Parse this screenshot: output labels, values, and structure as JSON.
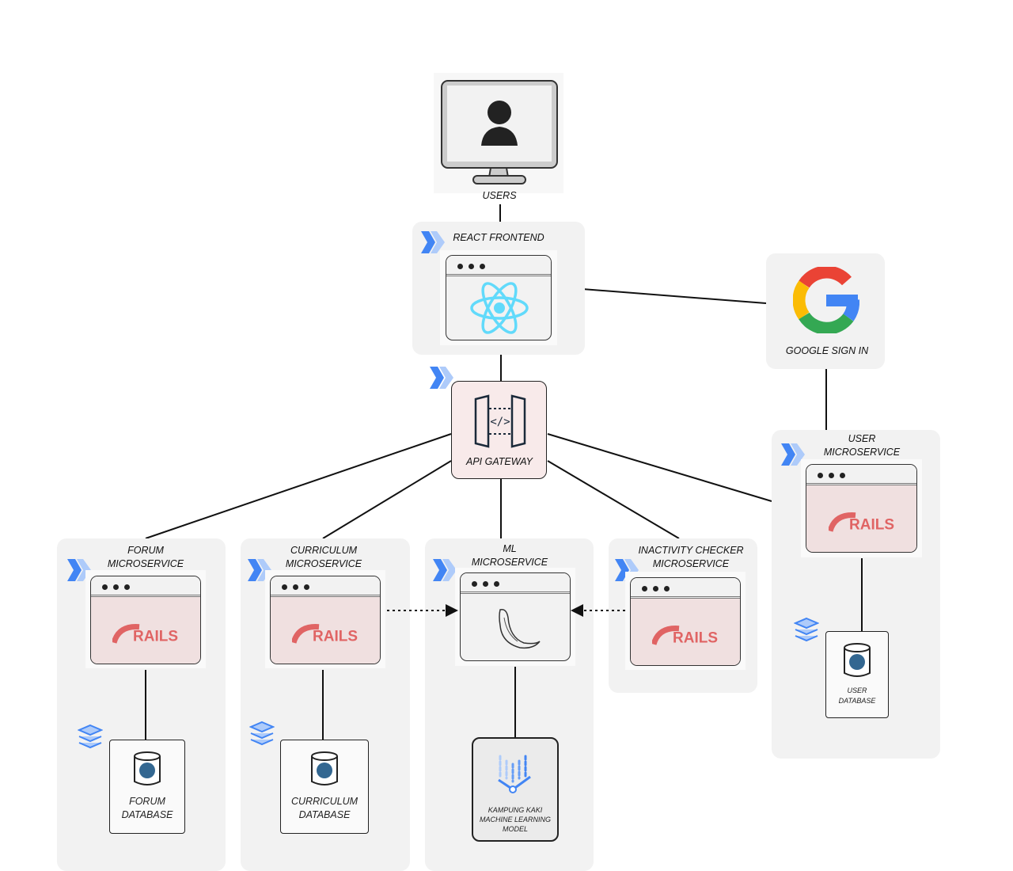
{
  "users": {
    "label": "USERS"
  },
  "frontend": {
    "label": "REACT FRONTEND"
  },
  "google": {
    "label": "GOOGLE SIGN IN"
  },
  "gateway": {
    "label": "API GATEWAY"
  },
  "user_service": {
    "label1": "USER",
    "label2": "MICROSERVICE",
    "db1": "USER",
    "db2": "DATABASE"
  },
  "forum_service": {
    "label1": "FORUM",
    "label2": "MICROSERVICE",
    "db1": "FORUM",
    "db2": "DATABASE"
  },
  "curriculum_service": {
    "label1": "CURRICULUM",
    "label2": "MICROSERVICE",
    "db1": "CURRICULUM",
    "db2": "DATABASE"
  },
  "ml_service": {
    "label1": "ML",
    "label2": "MICROSERVICE",
    "model1": "KAMPUNG KAKI",
    "model2": "MACHINE LEARNING",
    "model3": "MODEL"
  },
  "inactivity_service": {
    "label1": "INACTIVITY CHECKER",
    "label2": "MICROSERVICE"
  },
  "rails_text": "RAILS",
  "icons": [
    "cloud-run-icon",
    "react-icon",
    "rails-icon",
    "flask-icon",
    "postgres-icon",
    "cloud-sql-icon",
    "google-icon",
    "api-gateway-icon",
    "user-monitor-icon",
    "vertex-ai-icon"
  ],
  "colors": {
    "panel": "#f2f2f2",
    "rails": "#e06464",
    "react": "#61dafb",
    "cloud_run": "#4285f4",
    "gateway_bg": "#f8eaea"
  }
}
